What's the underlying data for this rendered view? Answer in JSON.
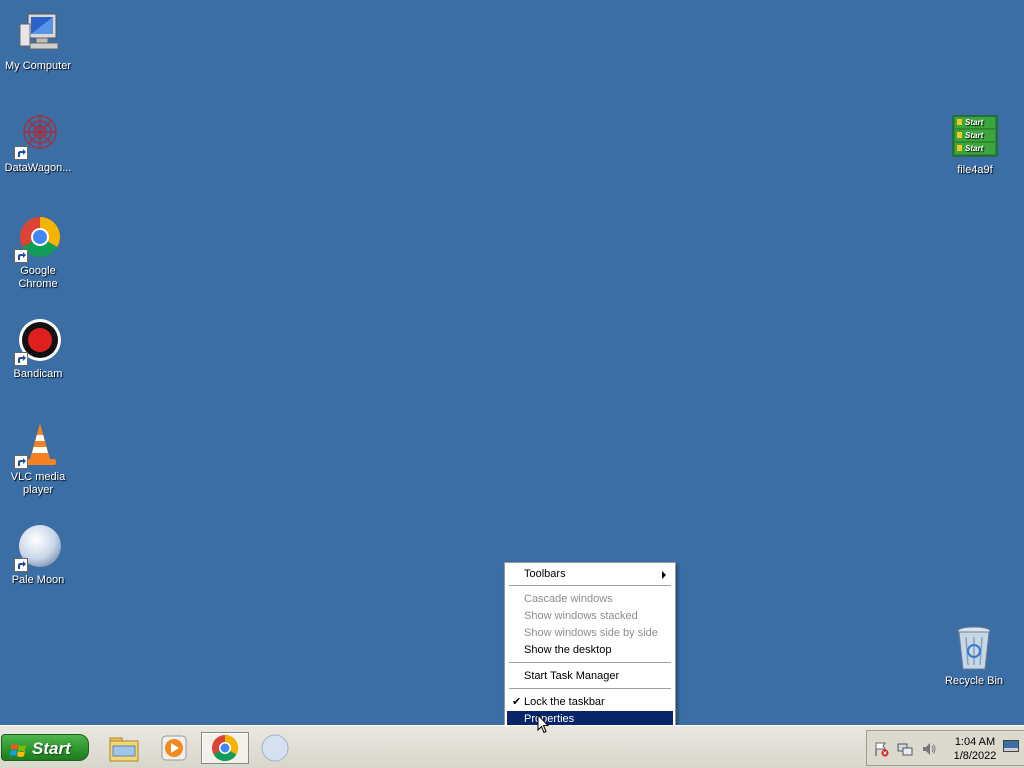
{
  "desktop_icons": {
    "my_computer": "My Computer",
    "datawagon": "DataWagon...",
    "chrome": "Google Chrome",
    "bandicam": "Bandicam",
    "vlc_line1": "VLC media",
    "vlc_line2": "player",
    "palemoon": "Pale Moon",
    "file": "file4a9f",
    "recycle": "Recycle Bin",
    "file_start_label": "Start"
  },
  "context_menu": {
    "toolbars": "Toolbars",
    "cascade": "Cascade windows",
    "stacked": "Show windows stacked",
    "side_by_side": "Show windows side by side",
    "show_desktop": "Show the desktop",
    "task_manager": "Start Task Manager",
    "lock_taskbar": "Lock the taskbar",
    "properties": "Properties",
    "check_mark": "✔"
  },
  "taskbar": {
    "start": "Start",
    "time": "1:04 AM",
    "date": "1/8/2022"
  },
  "colors": {
    "desktop": "#3a6ea5",
    "menu_highlight": "#0a246a",
    "start_green": "#2e962e"
  }
}
